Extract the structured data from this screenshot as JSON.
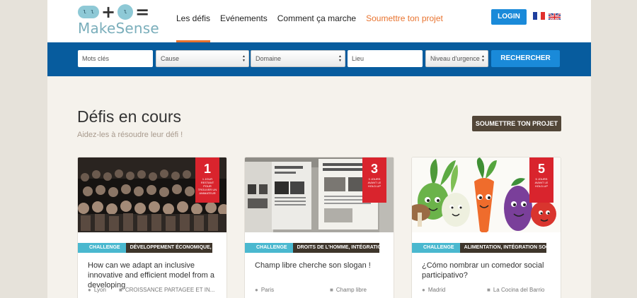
{
  "header": {
    "logo_text": "MakeSense",
    "nav": [
      {
        "label": "Les défis"
      },
      {
        "label": "Evénements"
      },
      {
        "label": "Comment ça marche"
      },
      {
        "label": "Soumettre ton projet"
      }
    ],
    "login_label": "LOGIN"
  },
  "search": {
    "keywords_placeholder": "Mots clés",
    "cause": "Cause",
    "domain": "Domaine",
    "place_placeholder": "Lieu",
    "urgency": "Niveau d'urgence",
    "button_label": "RECHERCHER"
  },
  "main": {
    "title": "Défis en cours",
    "subtitle": "Aidez-les à résoudre leur défi !",
    "submit_label": "SOUMETTRE TON PROJET"
  },
  "cards": [
    {
      "badge_number": "1",
      "badge_text": "1 JOUR RESTANT POUR TROUVER UN ANIMATEUR",
      "tag": "CHALLENGE",
      "category": "DÉVELOPPEMENT ÉCONOMIQUE, IN...",
      "title": "How can we adapt an inclusive innovative and efficient model from a developing",
      "location": "Lyon",
      "org": "CROISSANCE PARTAGEE ET IN..."
    },
    {
      "badge_number": "3",
      "badge_text": "3 JOURS AVANT LE HOLD-UP",
      "tag": "CHALLENGE",
      "category": "DROITS DE L'HOMME, INTÉGRATION ...",
      "title": "Champ libre cherche son slogan !",
      "location": "Paris",
      "org": "Champ libre"
    },
    {
      "badge_number": "5",
      "badge_text": "5 JOURS AVANT LE HOLD-UP",
      "tag": "CHALLENGE",
      "category": "ALIMENTATION, INTÉGRATION SOCI...",
      "title": "¿Cómo nombrar un comedor social participativo?",
      "location": "Madrid",
      "org": "La Cocina del Barrio"
    }
  ],
  "colors": {
    "accent_orange": "#e8732f",
    "search_bar_blue": "#075c9e",
    "button_blue": "#1a8ad9",
    "badge_red": "#d9242d",
    "challenge_teal": "#4ab8cf",
    "dark_brown": "#524638"
  },
  "icons": {
    "location": "map-pin-icon",
    "organization": "briefcase-icon",
    "select_arrows": "up-down-arrows-icon"
  }
}
